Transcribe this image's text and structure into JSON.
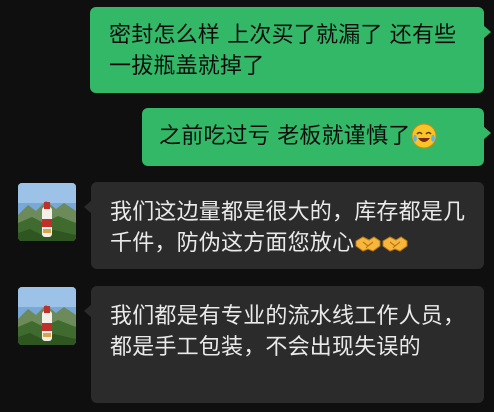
{
  "messages": [
    {
      "direction": "out",
      "text": "密封怎么样 上次买了就漏了  还有些一拔瓶盖就掉了"
    },
    {
      "direction": "out",
      "text": "之前吃过亏 老板就谨慎了",
      "emoji": "laughing-crying-emoji"
    },
    {
      "direction": "in",
      "text": "我们这边量都是很大的，库存都是几千件，防伪这方面您放心",
      "emoji": "handshake-emoji"
    },
    {
      "direction": "in",
      "text": "我们都是有专业的流水线工作人员，都是手工包装，不会出现失误的"
    }
  ],
  "colors": {
    "background": "#0f0f0f",
    "outgoing_bubble": "#33b868",
    "incoming_bubble": "#2b2b2b"
  }
}
